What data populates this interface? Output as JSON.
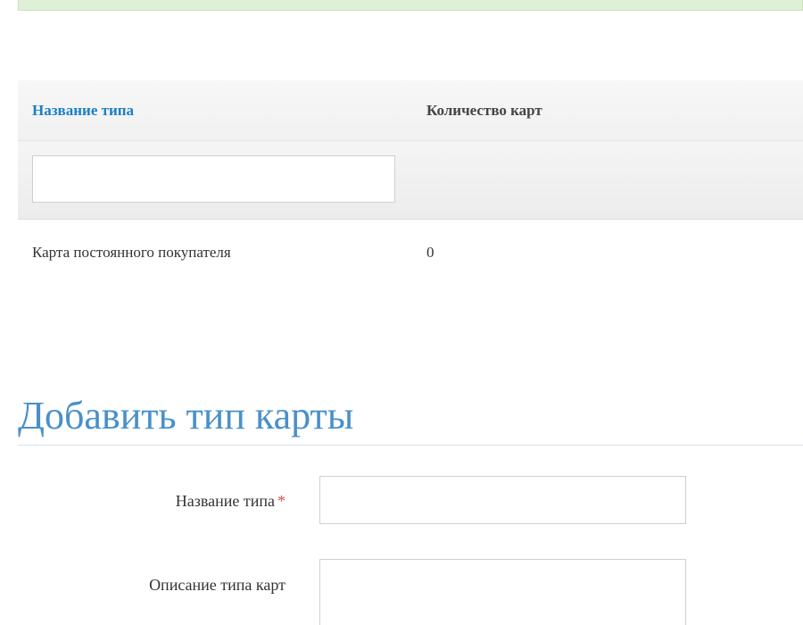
{
  "grid": {
    "columns": {
      "name": "Название типа",
      "count": "Количество карт"
    },
    "filter": {
      "value": "",
      "placeholder": ""
    },
    "rows": [
      {
        "name": "Карта постоянного покупателя",
        "count": "0"
      }
    ]
  },
  "form": {
    "title": "Добавить тип карты",
    "type_name_label": "Название типа",
    "required_marker": "*",
    "description_label": "Описание типа карт",
    "type_name_value": "",
    "description_value": ""
  },
  "colors": {
    "accent": "#4a90c8",
    "link": "#1a7fc1",
    "required": "#e04b4b",
    "banner": "#dff0d8"
  }
}
